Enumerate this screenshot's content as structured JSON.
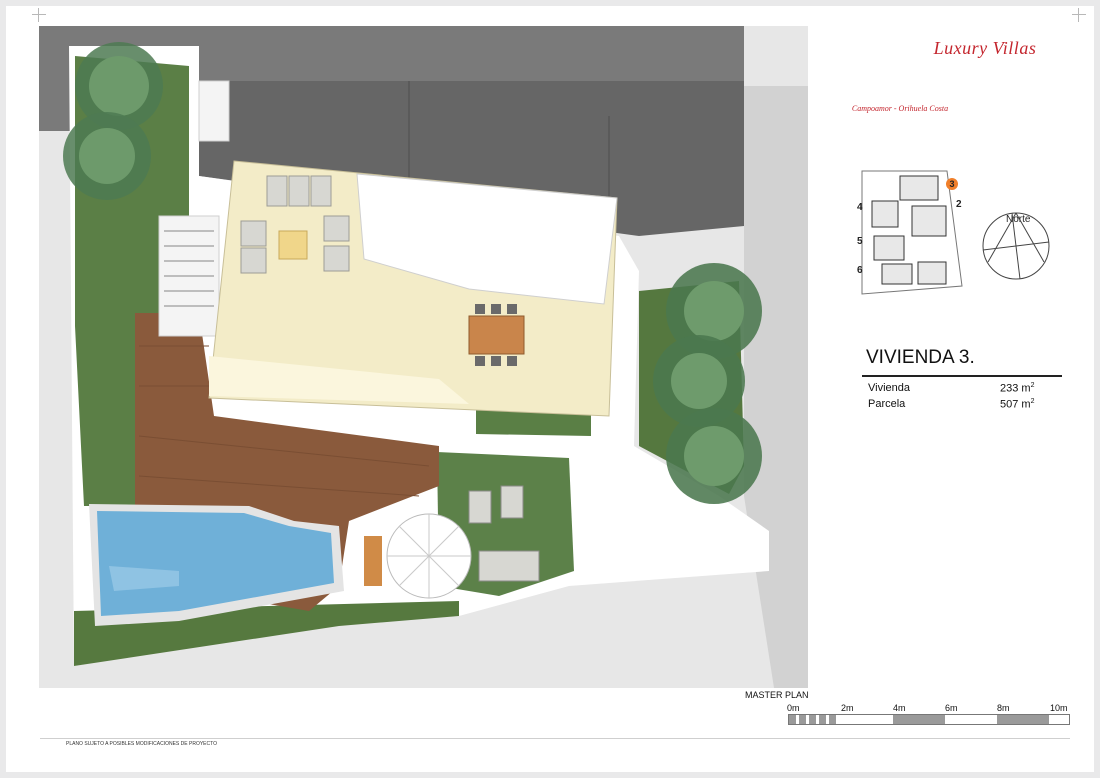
{
  "header": {
    "brand": "Luxury Villas",
    "location": "Campoamor - Orihuela Costa"
  },
  "keyplan": {
    "labels": [
      "3",
      "2",
      "4",
      "5",
      "6"
    ],
    "active": "3",
    "north_label": "Norte"
  },
  "unit": {
    "title": "VIVIENDA 3.",
    "areas": [
      {
        "label": "Vivienda",
        "value": "233 m",
        "unit_sup": "2"
      },
      {
        "label": "Parcela",
        "value": "507 m",
        "unit_sup": "2"
      }
    ]
  },
  "scale": {
    "title": "MASTER PLAN",
    "ticks": [
      "0m",
      "2m",
      "4m",
      "6m",
      "8m",
      "10m"
    ]
  },
  "footer": {
    "disclaimer": "PLANO SUJETO A POSIBLES MODIFICACIONES DE PROYECTO"
  },
  "colors": {
    "brand_red": "#c4262e",
    "lawn": "#5b7f46",
    "deck": "#8a5a3c",
    "pool": "#6fb0d8",
    "paving_dark": "#6d6d6d",
    "terrace": "#f3ecc8"
  }
}
